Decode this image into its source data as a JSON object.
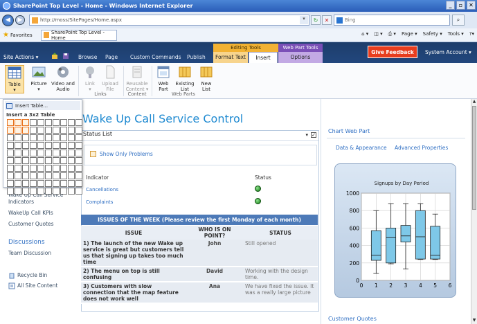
{
  "browser": {
    "title": "SharePoint Top Level - Home - Windows Internet Explorer",
    "url": "http://moss/SitePages/Home.aspx",
    "search_placeholder": "Bing",
    "favorites_label": "Favorites",
    "tab_title": "SharePoint Top Level - Home",
    "commands": [
      "Page ▾",
      "Safety ▾",
      "Tools ▾"
    ]
  },
  "ribbon_header": {
    "site_actions": "Site Actions ▾",
    "tabs": [
      "Browse",
      "Page",
      "Custom Commands",
      "Publish"
    ],
    "editing_tools": "Editing Tools",
    "web_part_tools": "Web Part Tools",
    "format_text": "Format Text",
    "insert": "Insert",
    "options": "Options",
    "feedback": "Give Feedback",
    "account": "System Account ▾"
  },
  "ribbon": {
    "buttons": [
      {
        "label": "Table",
        "sub": "▾"
      },
      {
        "label": "Picture",
        "sub": "▾"
      },
      {
        "label": "Video and",
        "sub": "Audio"
      },
      {
        "label": "Link",
        "sub": "▾"
      },
      {
        "label": "Upload",
        "sub": "File"
      },
      {
        "label": "Reusable",
        "sub": "Content ▾"
      },
      {
        "label": "Web",
        "sub": "Part"
      },
      {
        "label": "Existing",
        "sub": "List"
      },
      {
        "label": "New",
        "sub": "List"
      }
    ],
    "groups": [
      "Links",
      "Content",
      "Web Parts"
    ]
  },
  "table_menu": {
    "insert_table": "Insert Table...",
    "grid_label": "Insert a 3x2 Table",
    "cols": 10,
    "rows": 10,
    "sel_cols": 3,
    "sel_rows": 2
  },
  "leftnav": {
    "partial_item": "Wake Up Call Service",
    "items": [
      "Indicators",
      "WakeUp Call KPIs",
      "Customer Quotes"
    ],
    "discussions": "Discussions",
    "team_discussion": "Team Discussion",
    "recycle_bin": "Recycle Bin",
    "all_site_content": "All Site Content"
  },
  "content": {
    "title": "Wake Up Call Service Control",
    "webpart_title": "Status List",
    "show_only": "Show Only Problems",
    "col_indicator": "Indicator",
    "col_status": "Status",
    "kpis": [
      "Cancellations",
      "Complaints"
    ],
    "issues_banner": "ISSUES OF THE WEEK (Please review the first Monday of each month)",
    "issues_headers": [
      "ISSUE",
      "WHO IS ON POINT?",
      "STATUS"
    ],
    "issues": [
      {
        "issue": "1) The launch of the new Wake up service is great but customers tell us that signing up takes too much time",
        "who": "John",
        "status": "Still opened"
      },
      {
        "issue": "2) The menu on top is still confusing",
        "who": "David",
        "status": "Working with the design time."
      },
      {
        "issue": "3) Customers with slow connection that the map feature does not work well",
        "who": "Ana",
        "status": "We have fixed the issue. It was a really large picture"
      }
    ]
  },
  "right": {
    "chart_title": "Chart Web Part",
    "links": [
      "Data & Appearance",
      "Advanced Properties"
    ],
    "customer_quotes": "Customer Quotes"
  },
  "chart_data": {
    "type": "boxplot",
    "title": "Signups by Day Period",
    "x": [
      1,
      2,
      3,
      4,
      5
    ],
    "xlim": [
      0,
      6
    ],
    "xticks": [
      0,
      1,
      2,
      3,
      4,
      5,
      6
    ],
    "ylim": [
      0,
      1000
    ],
    "yticks": [
      0,
      200,
      400,
      600,
      800,
      1000
    ],
    "boxes": [
      {
        "x": 1,
        "min": 80,
        "q1": 230,
        "median": 290,
        "q3": 570,
        "max": 800
      },
      {
        "x": 2,
        "min": 190,
        "q1": 200,
        "median": 490,
        "q3": 600,
        "max": 880
      },
      {
        "x": 3,
        "min": 130,
        "q1": 440,
        "median": 510,
        "q3": 630,
        "max": 880
      },
      {
        "x": 4,
        "min": 240,
        "q1": 245,
        "median": 500,
        "q3": 800,
        "max": 880
      },
      {
        "x": 5,
        "min": 240,
        "q1": 245,
        "median": 290,
        "q3": 620,
        "max": 760
      }
    ],
    "box_color": "#7ec8e8"
  }
}
